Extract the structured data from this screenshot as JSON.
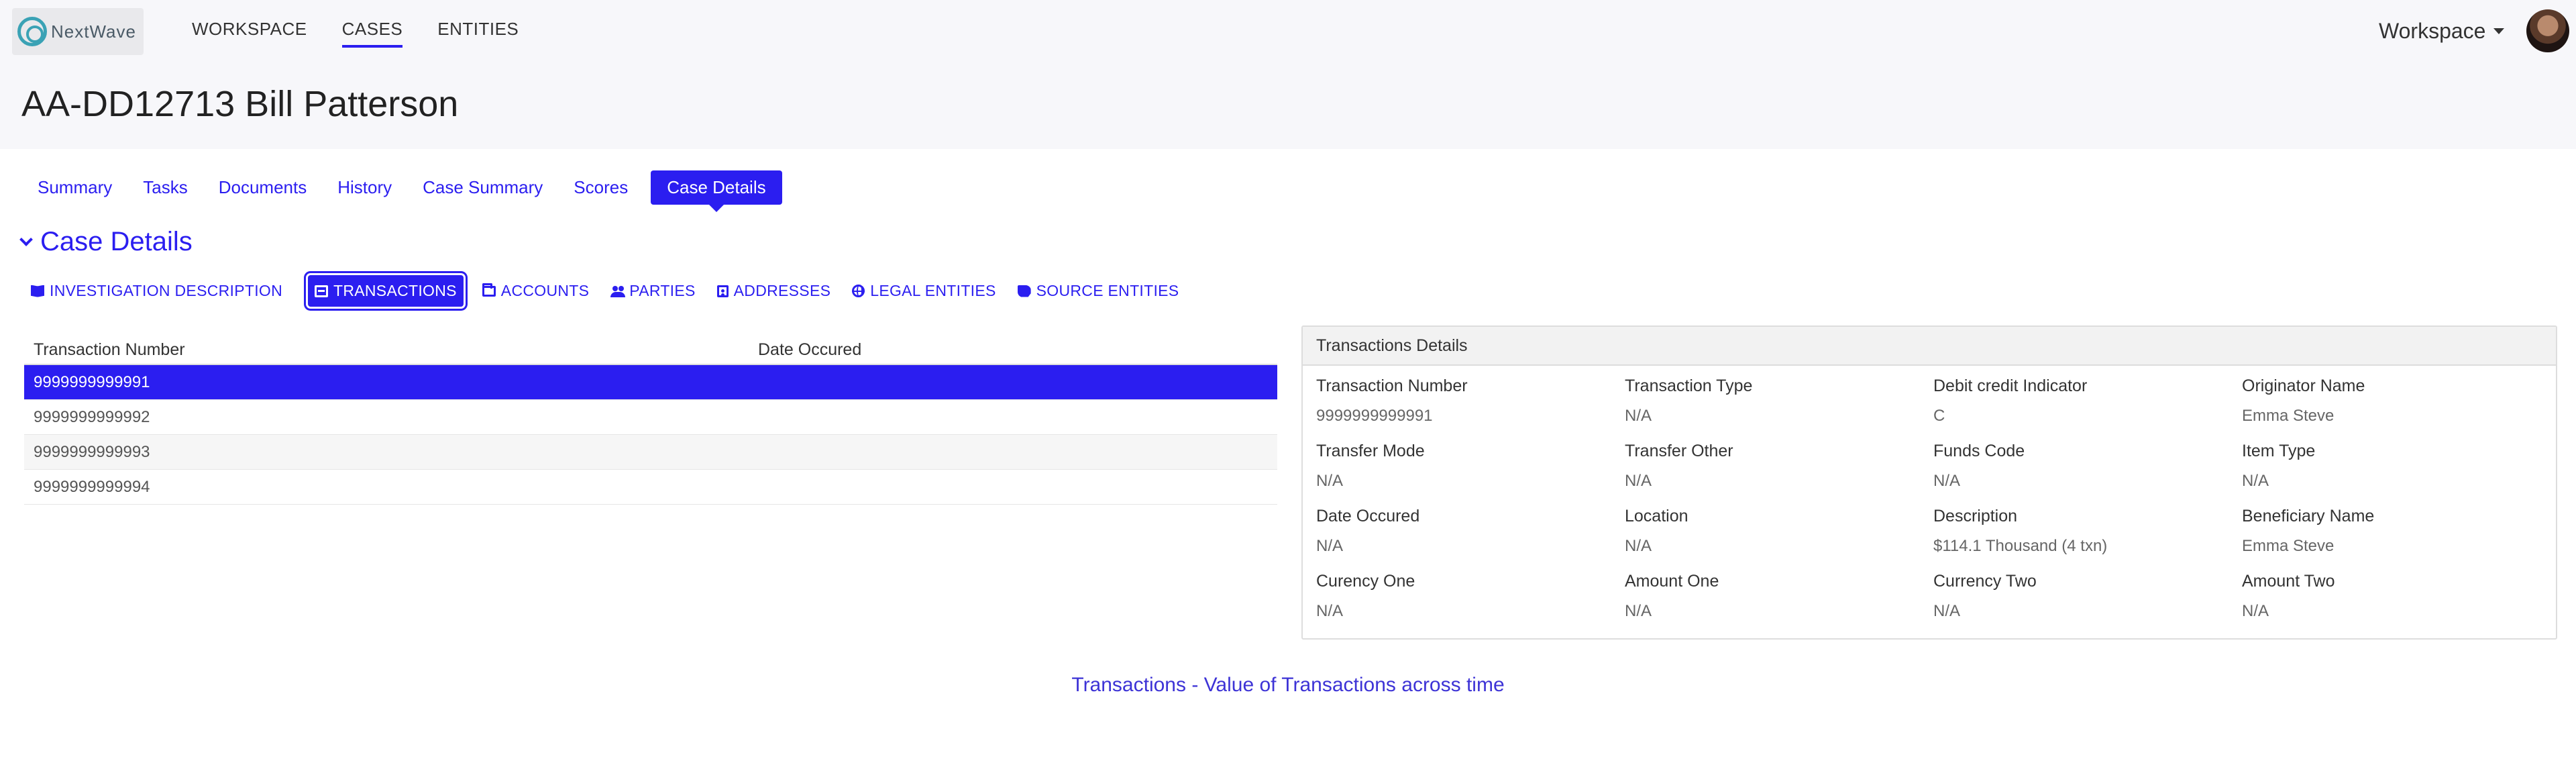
{
  "header": {
    "logo_text": "NextWave",
    "nav": [
      {
        "label": "WORKSPACE",
        "active": false
      },
      {
        "label": "CASES",
        "active": true
      },
      {
        "label": "ENTITIES",
        "active": false
      }
    ],
    "workspace_label": "Workspace"
  },
  "page_title": "AA-DD12713 Bill Patterson",
  "main_tabs": [
    "Summary",
    "Tasks",
    "Documents",
    "History",
    "Case Summary",
    "Scores",
    "Case Details"
  ],
  "main_tabs_active": "Case Details",
  "section_title": "Case Details",
  "sub_tabs": [
    {
      "label": "INVESTIGATION DESCRIPTION",
      "icon": "book-icon"
    },
    {
      "label": "TRANSACTIONS",
      "icon": "credit-card-icon",
      "active": true
    },
    {
      "label": "ACCOUNTS",
      "icon": "folder-icon"
    },
    {
      "label": "PARTIES",
      "icon": "users-icon"
    },
    {
      "label": "ADDRESSES",
      "icon": "address-book-icon"
    },
    {
      "label": "LEGAL ENTITIES",
      "icon": "globe-icon"
    },
    {
      "label": "SOURCE ENTITIES",
      "icon": "scroll-icon"
    }
  ],
  "transactions_table": {
    "columns": [
      "Transaction Number",
      "Date Occured"
    ],
    "rows": [
      {
        "number": "9999999999991",
        "date": ""
      },
      {
        "number": "9999999999992",
        "date": ""
      },
      {
        "number": "9999999999993",
        "date": ""
      },
      {
        "number": "9999999999994",
        "date": ""
      }
    ],
    "selected_index": 0
  },
  "details": {
    "title": "Transactions Details",
    "fields": [
      [
        {
          "label": "Transaction Number",
          "value": "9999999999991"
        },
        {
          "label": "Transaction Type",
          "value": "N/A"
        },
        {
          "label": "Debit credit Indicator",
          "value": "C"
        },
        {
          "label": "Originator Name",
          "value": "Emma Steve"
        }
      ],
      [
        {
          "label": "Transfer Mode",
          "value": "N/A"
        },
        {
          "label": "Transfer Other",
          "value": "N/A"
        },
        {
          "label": "Funds Code",
          "value": "N/A"
        },
        {
          "label": "Item Type",
          "value": "N/A"
        }
      ],
      [
        {
          "label": "Date Occured",
          "value": "N/A"
        },
        {
          "label": "Location",
          "value": "N/A"
        },
        {
          "label": "Description",
          "value": "$114.1 Thousand (4 txn)"
        },
        {
          "label": "Beneficiary Name",
          "value": "Emma Steve"
        }
      ],
      [
        {
          "label": "Curency One",
          "value": "N/A"
        },
        {
          "label": "Amount One",
          "value": "N/A"
        },
        {
          "label": "Currency Two",
          "value": "N/A"
        },
        {
          "label": "Amount Two",
          "value": "N/A"
        }
      ]
    ]
  },
  "chart_title": "Transactions - Value of Transactions across time",
  "colors": {
    "accent": "#2b1ef0",
    "header_bg": "#f7f7fa"
  }
}
